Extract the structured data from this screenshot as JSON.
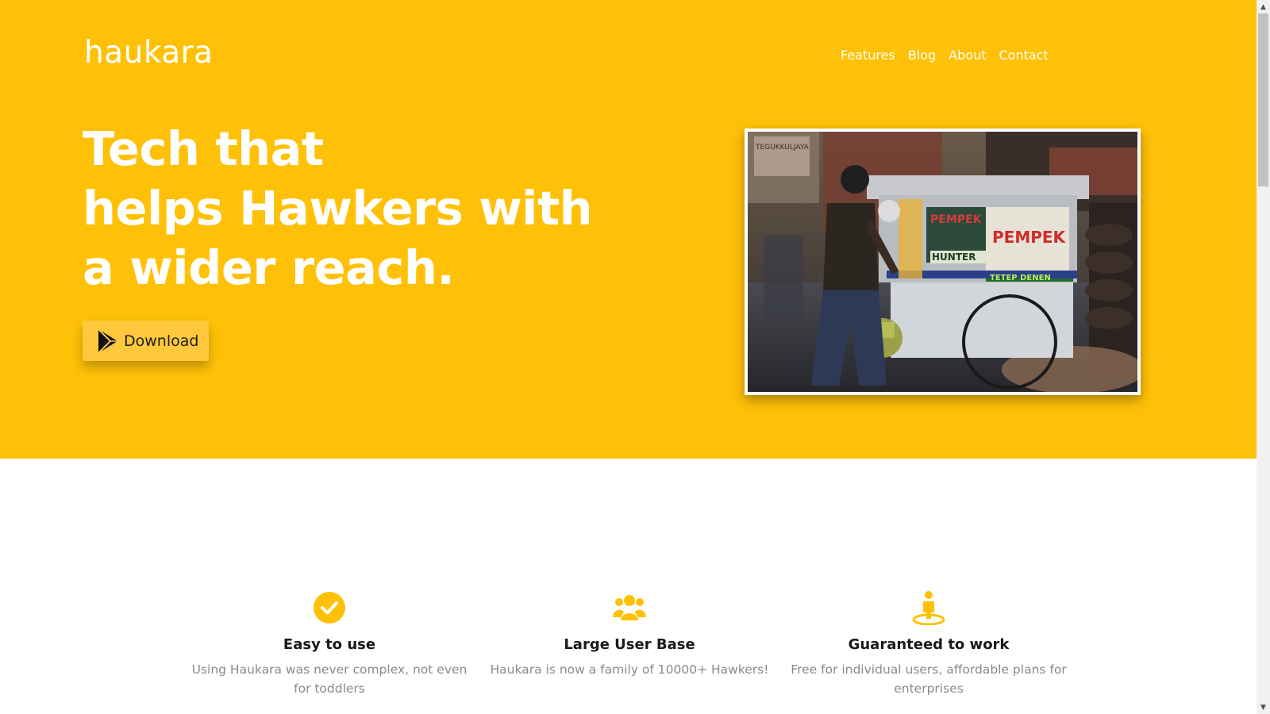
{
  "brand": {
    "logo_text": "haukara",
    "accent_color": "#ffc107"
  },
  "nav": {
    "items": [
      {
        "label": "Features"
      },
      {
        "label": "Blog"
      },
      {
        "label": "About"
      },
      {
        "label": "Contact"
      }
    ]
  },
  "hero": {
    "headline_lines": [
      "Tech that",
      "helps Hawkers with",
      "a wider reach."
    ],
    "download_label": "Download",
    "download_icon": "play-store-icon",
    "photo_alt": "street food cart"
  },
  "features": [
    {
      "icon": "check-circle-icon",
      "title": "Easy to use",
      "description": "Using Haukara was never complex, not even for toddlers"
    },
    {
      "icon": "users-icon",
      "title": "Large User Base",
      "description": "Haukara is now a family of 10000+ Hawkers!"
    },
    {
      "icon": "location-person-icon",
      "title": "Guaranteed to work",
      "description": "Free for individual users, affordable plans for enterprises"
    }
  ]
}
